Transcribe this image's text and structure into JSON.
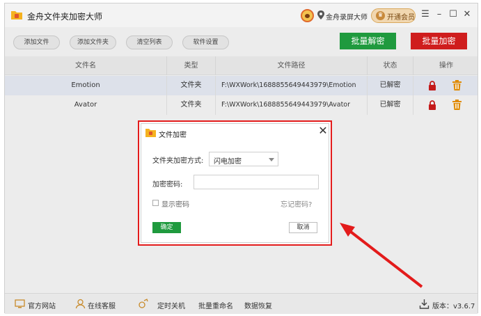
{
  "app": {
    "title": "金舟文件夹加密大师",
    "recorder_label": "金舟录屏大师",
    "vip_label": "开通会员",
    "win_menu": "☰",
    "win_min": "–",
    "win_max": "☐",
    "win_close": "✕"
  },
  "toolbar": {
    "add_file": "添加文件",
    "add_folder": "添加文件夹",
    "clear_list": "清空列表",
    "settings": "软件设置",
    "batch_decrypt": "批量解密",
    "batch_encrypt": "批量加密"
  },
  "table": {
    "headers": [
      "文件名",
      "类型",
      "文件路径",
      "状态",
      "操作"
    ],
    "rows": [
      {
        "name": "Emotion",
        "type": "文件夹",
        "path": "F:\\WXWork\\1688855649443979\\Emotion",
        "status": "已解密"
      },
      {
        "name": "Avator",
        "type": "文件夹",
        "path": "F:\\WXWork\\1688855649443979\\Avator",
        "status": "已解密"
      }
    ]
  },
  "statusbar": {
    "website": "官方网站",
    "support": "在线客服",
    "shutdown": "定时关机",
    "rename": "批量重命名",
    "recovery": "数据恢复",
    "version": "版本：v3.6.7"
  },
  "dialog": {
    "title": "文件加密",
    "close": "✕",
    "method_label": "文件夹加密方式:",
    "method_value": "闪电加密",
    "password_label": "加密密码:",
    "password_value": "",
    "show_password": "显示密码",
    "forgot_password": "忘记密码?",
    "ok": "确定",
    "cancel": "取消"
  },
  "colors": {
    "decrypt_green": "#1f9a3e",
    "encrypt_red": "#cf1d1d",
    "highlight_red": "#e31b1b"
  }
}
